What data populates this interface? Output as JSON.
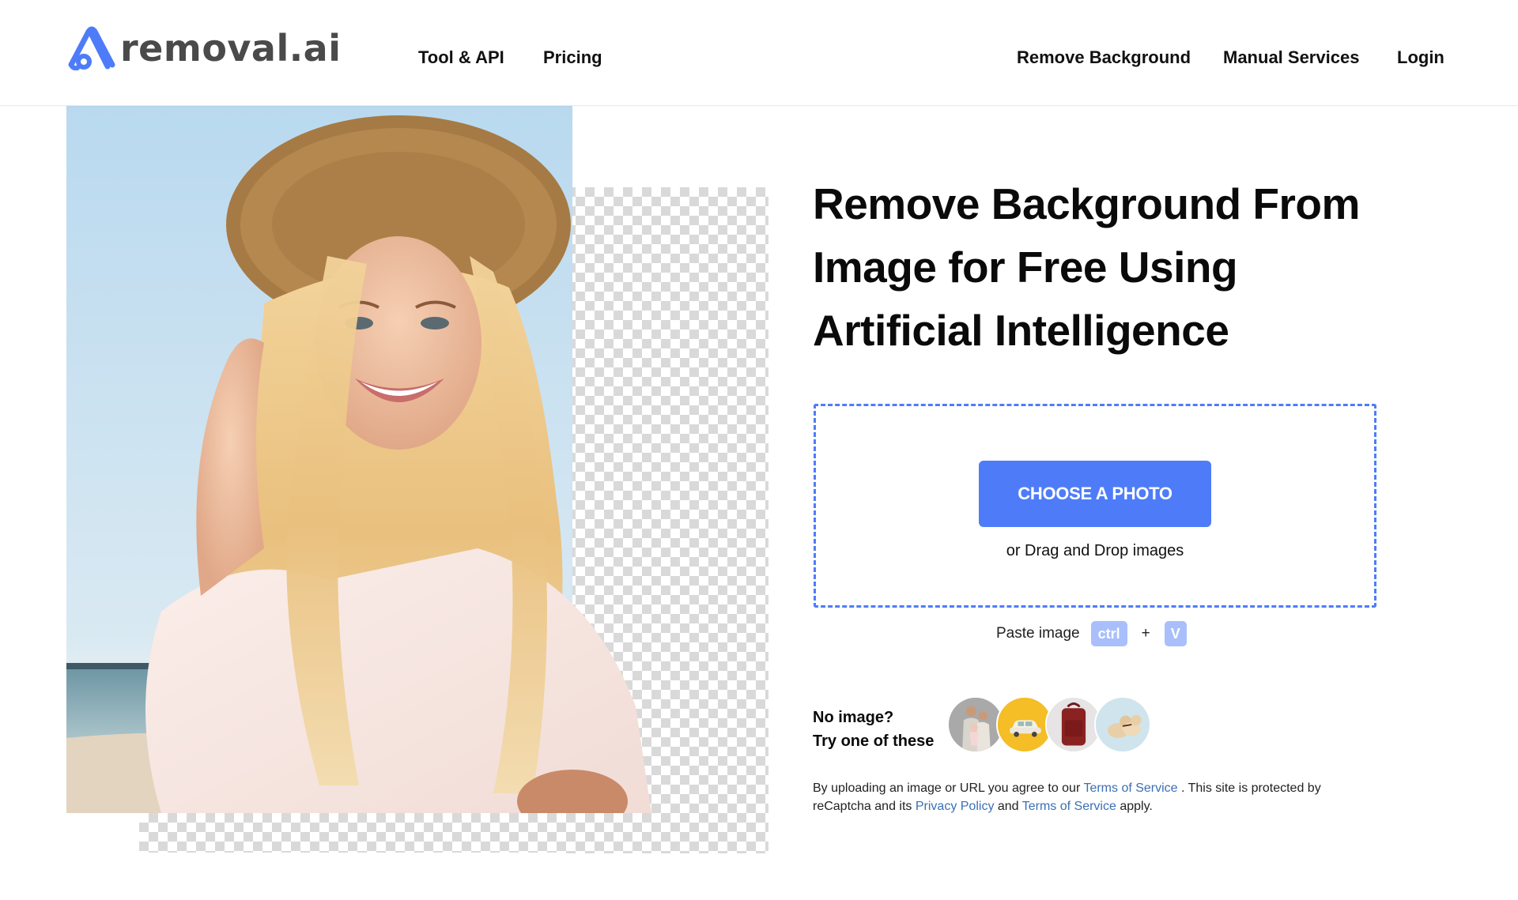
{
  "header": {
    "logo_text": "removal.ai",
    "nav_left": [
      {
        "label": "Tool & API"
      },
      {
        "label": "Pricing"
      }
    ],
    "nav_right": [
      {
        "label": "Remove Background"
      },
      {
        "label": "Manual Services"
      },
      {
        "label": "Login"
      }
    ]
  },
  "hero": {
    "image_alt": "Smiling woman in straw hat on beach with background partially removed (transparency checkerboard)",
    "icons": {
      "logo": "removal-ai-logo-icon"
    }
  },
  "main": {
    "headline_lines": [
      "Remove Background From",
      "Image for Free Using",
      "Artificial Intelligence"
    ],
    "upload": {
      "button_label": "CHOOSE A PHOTO",
      "drag_text": "or Drag and Drop images"
    },
    "paste": {
      "label": "Paste image",
      "key1": "ctrl",
      "plus": "+",
      "key2": "V"
    },
    "samples": {
      "line1": "No image?",
      "line2": "Try one of these",
      "items": [
        {
          "name": "family"
        },
        {
          "name": "car"
        },
        {
          "name": "backpack"
        },
        {
          "name": "dogs"
        }
      ]
    },
    "terms": {
      "part1": "By uploading an image or URL you agree to our ",
      "link1": "Terms of Service",
      "part2": " . This site is protected by reCaptcha and its ",
      "link2": "Privacy Policy",
      "part3": " and ",
      "link3": "Terms of Service",
      "part4": " apply."
    }
  },
  "colors": {
    "accent": "#4e7cf9",
    "key_badge": "#a9bffb",
    "link": "#3b6fb5",
    "text": "#111111"
  }
}
